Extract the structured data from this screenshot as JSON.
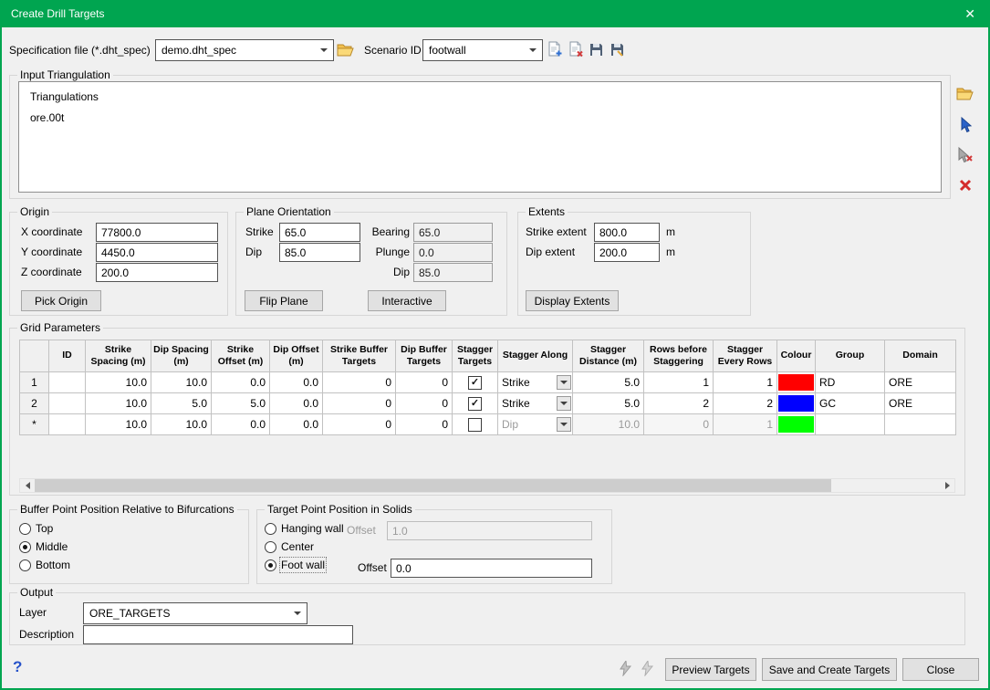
{
  "window": {
    "title": "Create Drill Targets",
    "close_glyph": "✕"
  },
  "toolbar": {
    "spec_label": "Specification file (*.dht_spec)",
    "spec_value": "demo.dht_spec",
    "scenario_label": "Scenario ID",
    "scenario_value": "footwall"
  },
  "input_triangulation": {
    "title": "Input Triangulation",
    "root_label": "Triangulations",
    "item_label": "ore.00t"
  },
  "origin": {
    "title": "Origin",
    "x_label": "X coordinate",
    "x_value": "77800.0",
    "y_label": "Y coordinate",
    "y_value": "4450.0",
    "z_label": "Z coordinate",
    "z_value": "200.0",
    "pick_button": "Pick Origin"
  },
  "plane": {
    "title": "Plane Orientation",
    "strike_label": "Strike",
    "strike_value": "65.0",
    "dip_label": "Dip",
    "dip_value": "85.0",
    "bearing_label": "Bearing",
    "bearing_value": "65.0",
    "plunge_label": "Plunge",
    "plunge_value": "0.0",
    "dip2_label": "Dip",
    "dip2_value": "85.0",
    "flip_button": "Flip Plane",
    "interactive_button": "Interactive"
  },
  "extents": {
    "title": "Extents",
    "strike_label": "Strike extent",
    "strike_value": "800.0",
    "strike_unit": "m",
    "dip_label": "Dip extent",
    "dip_value": "200.0",
    "dip_unit": "m",
    "display_button": "Display Extents"
  },
  "grid": {
    "title": "Grid Parameters",
    "columns": [
      "ID",
      "Strike Spacing (m)",
      "Dip Spacing (m)",
      "Strike Offset (m)",
      "Dip Offset (m)",
      "Strike Buffer Targets",
      "Dip Buffer Targets",
      "Stagger Targets",
      "Stagger Along",
      "Stagger Distance (m)",
      "Rows before Staggering",
      "Stagger Every Rows",
      "Colour",
      "Group",
      "Domain"
    ],
    "rows": [
      {
        "header": "1",
        "id": "",
        "strike_spacing": "10.0",
        "dip_spacing": "10.0",
        "strike_offset": "0.0",
        "dip_offset": "0.0",
        "strike_buffer": "0",
        "dip_buffer": "0",
        "stagger_mark": "✓",
        "stagger_along": "Strike",
        "stagger_distance": "5.0",
        "rows_before": "1",
        "stagger_every": "1",
        "colour": "#ff0000",
        "group": "RD",
        "domain": "ORE"
      },
      {
        "header": "2",
        "id": "",
        "strike_spacing": "10.0",
        "dip_spacing": "5.0",
        "strike_offset": "5.0",
        "dip_offset": "0.0",
        "strike_buffer": "0",
        "dip_buffer": "0",
        "stagger_mark": "✓",
        "stagger_along": "Strike",
        "stagger_distance": "5.0",
        "rows_before": "2",
        "stagger_every": "2",
        "colour": "#0000ff",
        "group": "GC",
        "domain": "ORE"
      },
      {
        "header": "*",
        "id": "",
        "strike_spacing": "10.0",
        "dip_spacing": "10.0",
        "strike_offset": "0.0",
        "dip_offset": "0.0",
        "strike_buffer": "0",
        "dip_buffer": "0",
        "stagger_mark": "",
        "stagger_along": "Dip",
        "stagger_distance": "10.0",
        "rows_before": "0",
        "stagger_every": "1",
        "colour": "#00ff00",
        "group": "",
        "domain": ""
      }
    ]
  },
  "buffer_position": {
    "title": "Buffer Point Position Relative to Bifurcations",
    "options": [
      "Top",
      "Middle",
      "Bottom"
    ],
    "selected": "Middle"
  },
  "target_position": {
    "title": "Target Point Position in Solids",
    "hanging_label": "Hanging wall",
    "hanging_offset_label": "Offset",
    "hanging_offset_value": "1.0",
    "center_label": "Center",
    "foot_label": "Foot wall",
    "foot_offset_label": "Offset",
    "foot_offset_value": "0.0",
    "selected": "Foot wall"
  },
  "output": {
    "title": "Output",
    "layer_label": "Layer",
    "layer_value": "ORE_TARGETS",
    "description_label": "Description",
    "description_value": ""
  },
  "footer": {
    "help_glyph": "?",
    "preview_button": "Preview Targets",
    "save_button": "Save and Create Targets",
    "close_button": "Close"
  }
}
